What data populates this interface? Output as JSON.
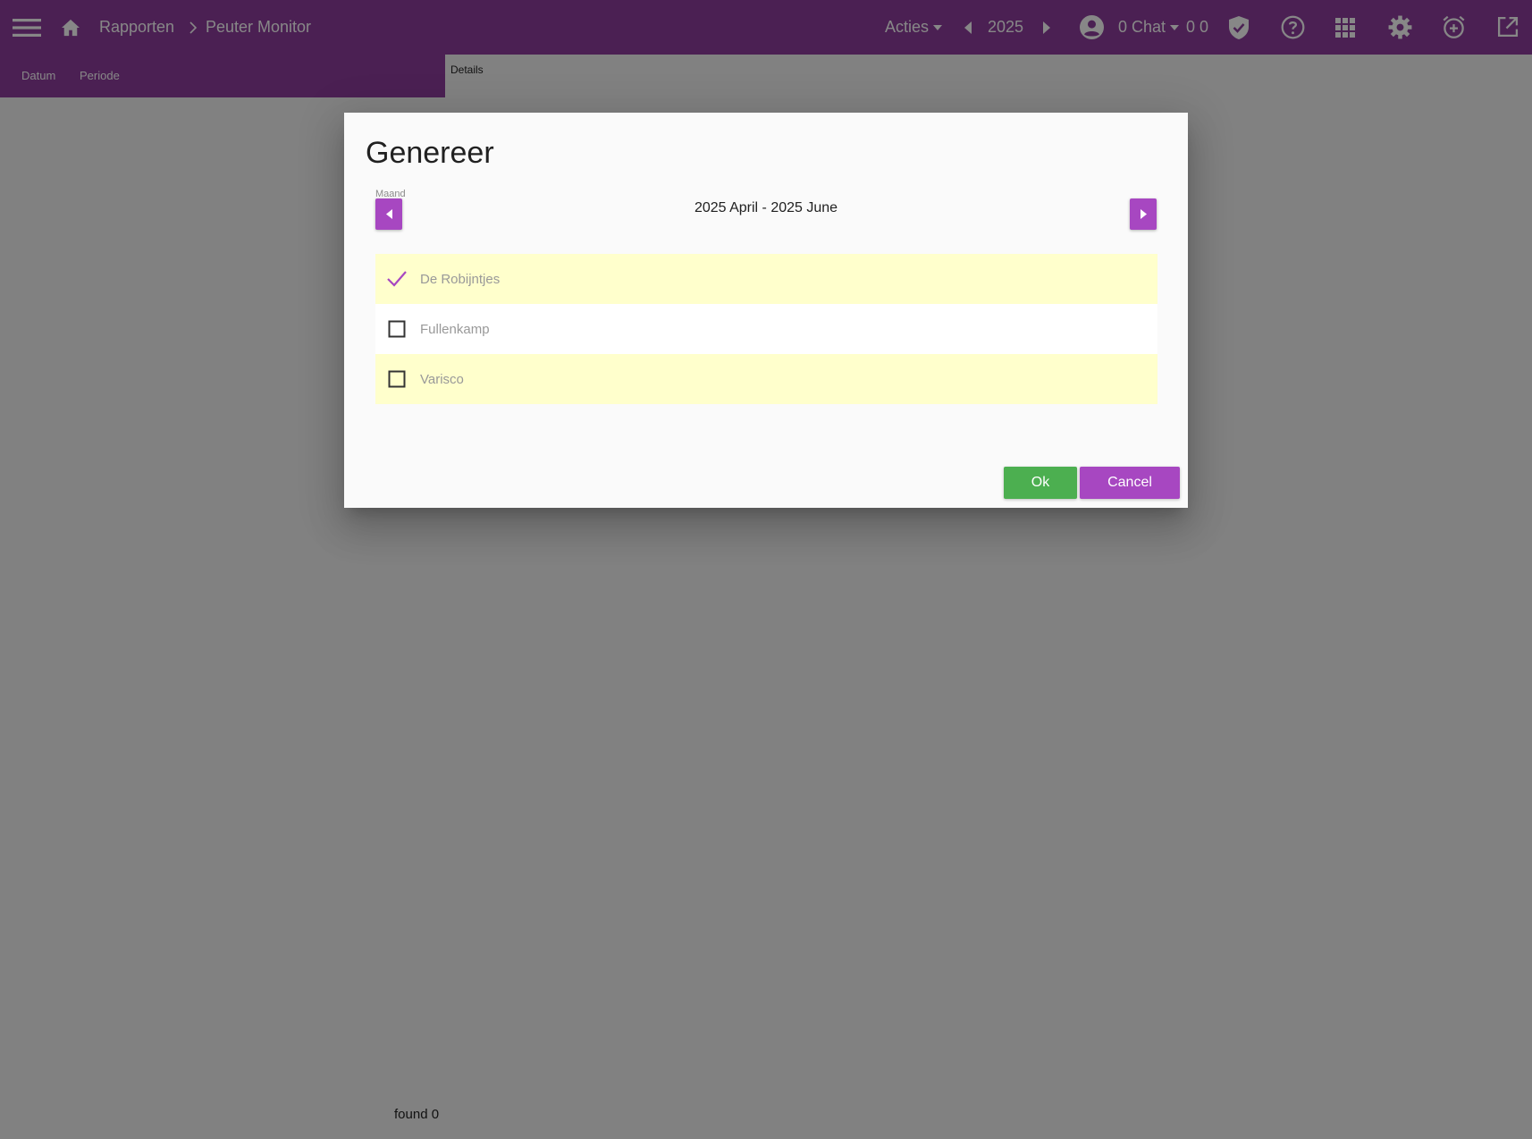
{
  "colors": {
    "primary": "#8e3e9e",
    "accent": "#a747c1",
    "ok_green": "#4caf50",
    "row_highlight": "#ffffcc"
  },
  "header": {
    "menu_icon": "hamburger-menu-icon",
    "home_icon": "home-icon",
    "breadcrumb": [
      "Rapporten",
      "Peuter Monitor"
    ],
    "acties_label": "Acties",
    "year": "2025",
    "chat_label": "0 Chat",
    "counters": "0 0",
    "icons": [
      "account-circle-icon",
      "shield-check-icon",
      "help-icon",
      "apps-grid-icon",
      "settings-gear-icon",
      "alarm-add-icon",
      "open-external-icon"
    ]
  },
  "subnav": {
    "tabs": [
      "Datum",
      "Periode"
    ],
    "details_label": "Details"
  },
  "footer": {
    "found_text": "found 0"
  },
  "dialog": {
    "title": "Genereer",
    "period_label": "Maand",
    "period_value": "2025 April - 2025 June",
    "locations": [
      {
        "name": "De Robijntjes",
        "checked": true
      },
      {
        "name": "Fullenkamp",
        "checked": false
      },
      {
        "name": "Varisco",
        "checked": false
      }
    ],
    "ok_label": "Ok",
    "cancel_label": "Cancel"
  }
}
